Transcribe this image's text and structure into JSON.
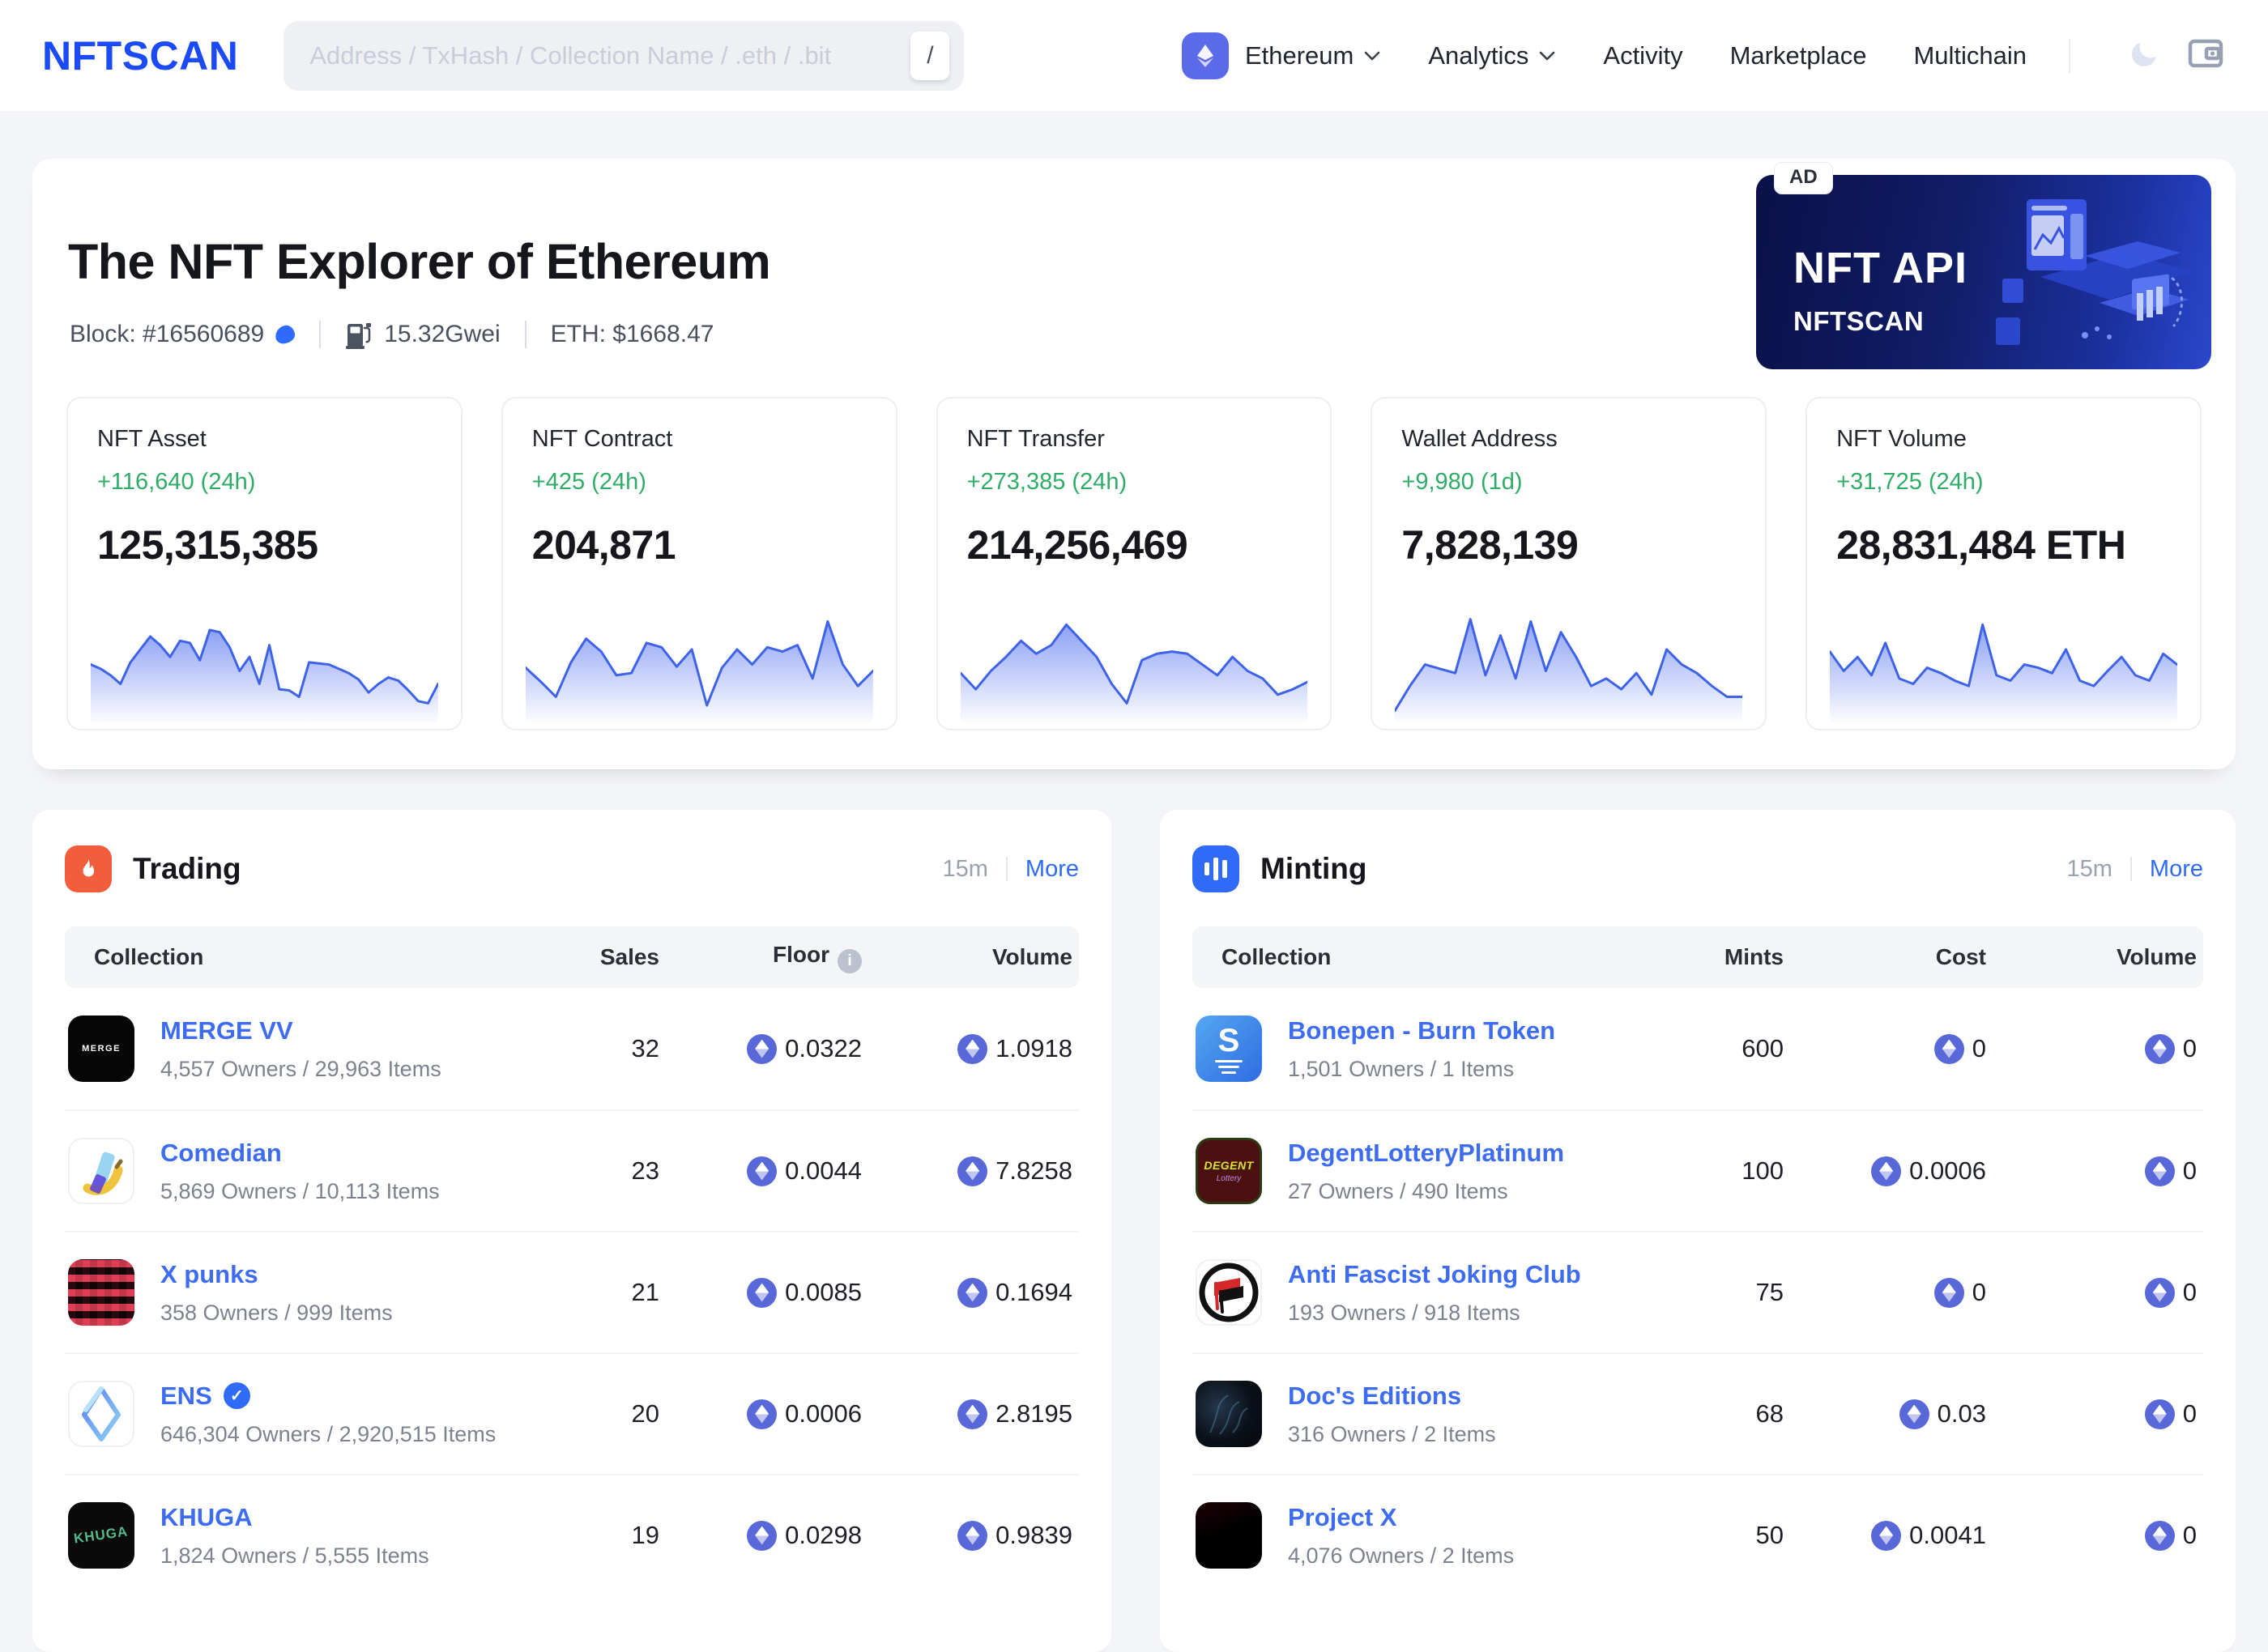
{
  "navbar": {
    "logo": "NFTSCAN",
    "search": {
      "placeholder": "Address / TxHash / Collection Name / .eth / .bit",
      "shortcut": "/"
    },
    "chain": {
      "label": "Ethereum"
    },
    "links": {
      "analytics": "Analytics",
      "activity": "Activity",
      "marketplace": "Marketplace",
      "multichain": "Multichain"
    }
  },
  "hero": {
    "title": "The NFT Explorer of Ethereum",
    "block_label": "Block: #16560689",
    "gas": "15.32Gwei",
    "eth_price": "ETH: $1668.47",
    "ad": {
      "badge": "AD",
      "title": "NFT API",
      "brand": "NFTSCAN"
    }
  },
  "stats": {
    "cards": [
      {
        "label": "NFT Asset",
        "delta": "+116,640 (24h)",
        "value": "125,315,385"
      },
      {
        "label": "NFT Contract",
        "delta": "+425 (24h)",
        "value": "204,871"
      },
      {
        "label": "NFT Transfer",
        "delta": "+273,385 (24h)",
        "value": "214,256,469"
      },
      {
        "label": "Wallet Address",
        "delta": "+9,980 (1d)",
        "value": "7,828,139"
      },
      {
        "label": "NFT Volume",
        "delta": "+31,725 (24h)",
        "value": "28,831,484 ETH"
      }
    ]
  },
  "chart_data": [
    {
      "type": "area",
      "title": "NFT Asset 24h sparkline",
      "x_axis": "hidden",
      "y_axis": "hidden",
      "values": [
        48,
        44,
        38,
        30,
        50,
        62,
        74,
        66,
        55,
        70,
        68,
        52,
        80,
        78,
        64,
        42,
        55,
        30,
        66,
        25,
        24,
        18,
        50,
        49,
        48,
        44,
        40,
        34,
        22,
        30,
        36,
        33,
        24,
        14,
        12,
        30
      ]
    },
    {
      "type": "area",
      "title": "NFT Contract 24h sparkline",
      "x_axis": "hidden",
      "y_axis": "hidden",
      "values": [
        45,
        32,
        18,
        50,
        72,
        60,
        38,
        40,
        68,
        64,
        46,
        62,
        10,
        45,
        62,
        48,
        64,
        60,
        66,
        35,
        88,
        48,
        28,
        42
      ]
    },
    {
      "type": "area",
      "title": "NFT Transfer 24h sparkline",
      "x_axis": "hidden",
      "y_axis": "hidden",
      "values": [
        40,
        25,
        42,
        55,
        70,
        58,
        66,
        85,
        70,
        55,
        30,
        12,
        52,
        58,
        60,
        58,
        48,
        38,
        55,
        42,
        35,
        20,
        25,
        32
      ]
    },
    {
      "type": "area",
      "title": "Wallet Address 1d sparkline",
      "x_axis": "hidden",
      "y_axis": "hidden",
      "values": [
        5,
        28,
        48,
        44,
        40,
        90,
        38,
        75,
        35,
        88,
        42,
        78,
        55,
        28,
        35,
        25,
        40,
        20,
        62,
        48,
        40,
        28,
        18,
        18
      ]
    },
    {
      "type": "area",
      "title": "NFT Volume 24h sparkline",
      "x_axis": "hidden",
      "y_axis": "hidden",
      "values": [
        60,
        42,
        55,
        38,
        68,
        35,
        30,
        45,
        40,
        33,
        28,
        85,
        38,
        33,
        48,
        45,
        40,
        62,
        33,
        28,
        42,
        55,
        38,
        33,
        58,
        48
      ]
    }
  ],
  "trading": {
    "title": "Trading",
    "interval": "15m",
    "more": "More",
    "columns": {
      "collection": "Collection",
      "sales": "Sales",
      "floor": "Floor",
      "volume": "Volume"
    },
    "rows": [
      {
        "name": "MERGE VV",
        "thumb_text": "MERGE",
        "sub": "4,557 Owners / 29,963 Items",
        "sales": "32",
        "floor": "0.0322",
        "volume": "1.0918"
      },
      {
        "name": "Comedian",
        "thumb_text": "",
        "sub": "5,869 Owners / 10,113 Items",
        "sales": "23",
        "floor": "0.0044",
        "volume": "7.8258"
      },
      {
        "name": "X punks",
        "thumb_text": "",
        "sub": "358 Owners / 999 Items",
        "sales": "21",
        "floor": "0.0085",
        "volume": "0.1694"
      },
      {
        "name": "ENS",
        "thumb_text": "",
        "sub": "646,304 Owners / 2,920,515 Items",
        "sales": "20",
        "floor": "0.0006",
        "volume": "2.8195"
      },
      {
        "name": "KHUGA",
        "thumb_text": "KHUGA",
        "sub": "1,824 Owners / 5,555 Items",
        "sales": "19",
        "floor": "0.0298",
        "volume": "0.9839"
      }
    ]
  },
  "minting": {
    "title": "Minting",
    "interval": "15m",
    "more": "More",
    "columns": {
      "collection": "Collection",
      "mints": "Mints",
      "cost": "Cost",
      "volume": "Volume"
    },
    "rows": [
      {
        "name": "Bonepen - Burn Token",
        "thumb_text": "S",
        "sub": "1,501 Owners / 1 Items",
        "mints": "600",
        "cost": "0",
        "volume": "0"
      },
      {
        "name": "DegentLotteryPlatinum",
        "thumb_d1": "DEGENT",
        "thumb_d2": "Lottery",
        "sub": "27 Owners / 490 Items",
        "mints": "100",
        "cost": "0.0006",
        "volume": "0"
      },
      {
        "name": "Anti Fascist Joking Club",
        "thumb_text": "",
        "sub": "193 Owners / 918 Items",
        "mints": "75",
        "cost": "0",
        "volume": "0"
      },
      {
        "name": "Doc's Editions",
        "thumb_text": "",
        "sub": "316 Owners / 2 Items",
        "mints": "68",
        "cost": "0.03",
        "volume": "0"
      },
      {
        "name": "Project X",
        "thumb_text": "",
        "sub": "4,076 Owners / 2 Items",
        "mints": "50",
        "cost": "0.0041",
        "volume": "0"
      }
    ]
  }
}
